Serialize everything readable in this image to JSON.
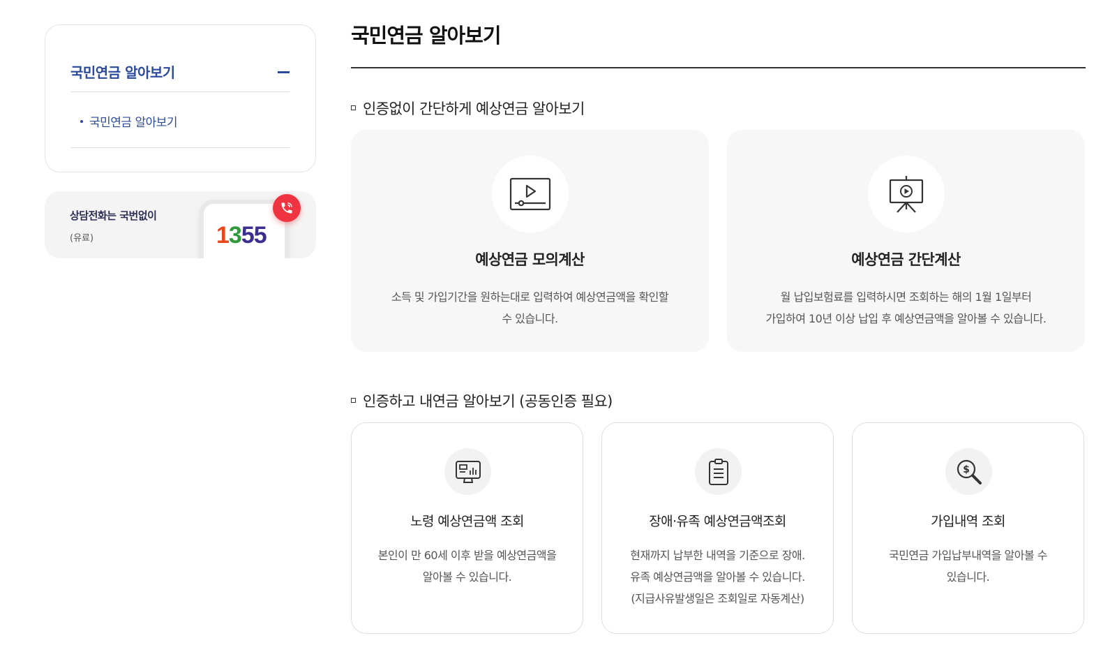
{
  "sidebar": {
    "menu_title": "국민연금 알아보기",
    "sub_items": [
      {
        "label": "국민연금 알아보기"
      }
    ],
    "call": {
      "title": "상담전화는 국번없이",
      "note": "(유료)",
      "number_parts": [
        "1",
        "3",
        "55"
      ]
    }
  },
  "main": {
    "page_title": "국민연금 알아보기",
    "section1": {
      "title": "인증없이 간단하게 예상연금 알아보기",
      "cards": [
        {
          "icon": "video-play-icon",
          "title": "예상연금 모의계산",
          "desc_line1": "소득 및 가입기간을 원하는대로 입력하여 예상연금액을 확인할",
          "desc_line2": "수 있습니다."
        },
        {
          "icon": "presentation-icon",
          "title": "예상연금 간단계산",
          "desc_line1": "월 납입보험료를 입력하시면 조회하는 해의 1월 1일부터",
          "desc_line2": "가입하여 10년 이상 납입 후 예상연금액을 알아볼 수 있습니다."
        }
      ]
    },
    "section2": {
      "title": "인증하고 내연금 알아보기 (공동인증 필요)",
      "cards": [
        {
          "icon": "monitor-chart-icon",
          "title": "노령 예상연금액 조회",
          "desc_line1": "본인이 만 60세 이후 받을 예상연금액을",
          "desc_line2": "알아볼 수 있습니다.",
          "desc_line3": ""
        },
        {
          "icon": "clipboard-icon",
          "title": "장애·유족 예상연금액조회",
          "desc_line1": "현재까지 납부한 내역을 기준으로 장애.",
          "desc_line2": "유족 예상연금액을 알아볼 수 있습니다.",
          "desc_line3": "(지급사유발생일은 조회일로 자동계산)"
        },
        {
          "icon": "money-search-icon",
          "title": "가입내역 조회",
          "desc_line1": "국민연금 가입납부내역을 알아볼 수",
          "desc_line2": "있습니다.",
          "desc_line3": ""
        }
      ]
    }
  },
  "colors": {
    "accent": "#2c4a9c",
    "call_red": "#ef3340",
    "digit_orange": "#e8491c",
    "digit_green": "#2e9a3a",
    "digit_navy": "#3a2f8f"
  }
}
